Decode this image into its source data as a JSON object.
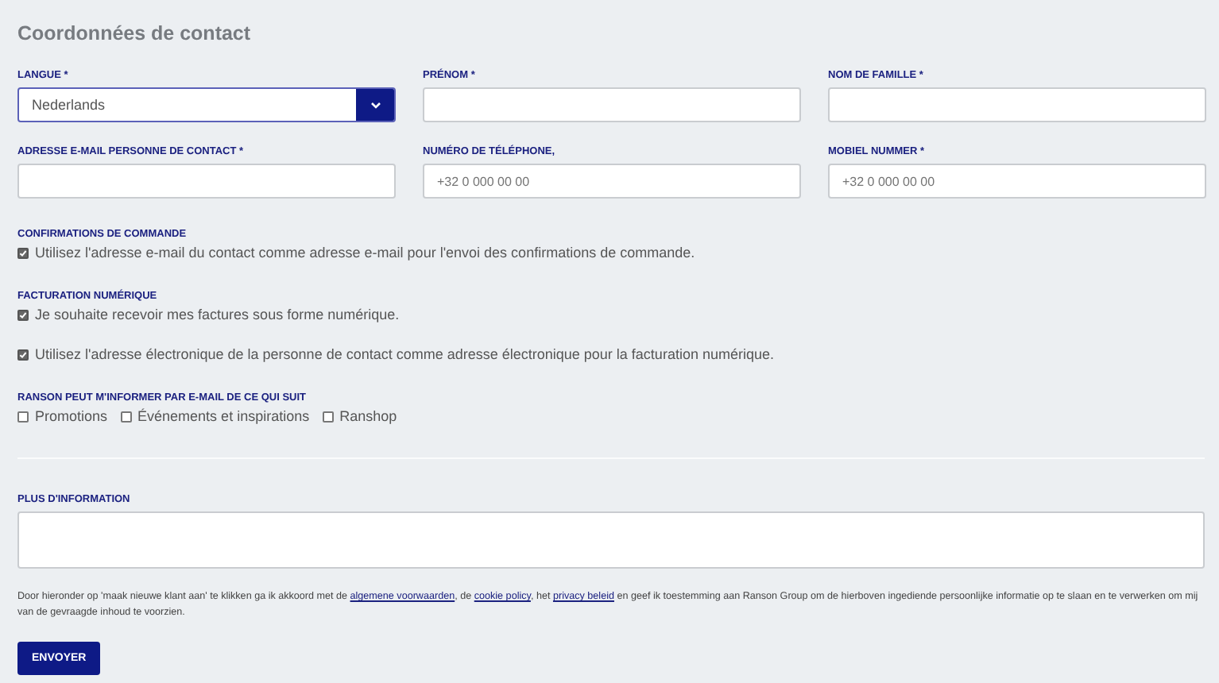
{
  "title": "Coordonnées de contact",
  "fields": [
    {
      "label": "LANGUE *",
      "kind": "select",
      "value": "Nederlands"
    },
    {
      "label": "PRÉNOM *",
      "kind": "text"
    },
    {
      "label": "NOM DE FAMILLE *",
      "kind": "text"
    },
    {
      "label": "ADRESSE E-MAIL PERSONNE DE CONTACT *",
      "kind": "text"
    },
    {
      "label": "NUMÉRO DE TÉLÉPHONE,",
      "kind": "text",
      "placeholder": "+32 0 000 00 00"
    },
    {
      "label": "MOBIEL NUMMER *",
      "kind": "text",
      "placeholder": "+32 0 000 00 00"
    }
  ],
  "groups": [
    {
      "heading": "CONFIRMATIONS DE COMMANDE",
      "inline": false,
      "options": [
        {
          "label": "Utilisez l'adresse e-mail du contact comme adresse e-mail pour l'envoi des confirmations de commande.",
          "checked": true
        }
      ]
    },
    {
      "heading": "FACTURATION NUMÉRIQUE",
      "inline": false,
      "options": [
        {
          "label": "Je souhaite recevoir mes factures sous forme numérique.",
          "checked": true
        },
        {
          "label": "Utilisez l'adresse électronique de la personne de contact comme adresse électronique pour la facturation numérique.",
          "checked": true
        }
      ]
    },
    {
      "heading": "RANSON PEUT M'INFORMER PAR E-MAIL DE CE QUI SUIT",
      "inline": true,
      "options": [
        {
          "label": "Promotions",
          "checked": false
        },
        {
          "label": "Événements et inspirations",
          "checked": false
        },
        {
          "label": "Ranshop",
          "checked": false
        }
      ]
    }
  ],
  "more_info": {
    "label": "PLUS D'INFORMATION"
  },
  "consent": [
    {
      "kind": "text",
      "text": "Door hieronder op 'maak nieuwe klant aan' te klikken ga ik akkoord met de "
    },
    {
      "kind": "link",
      "text": "algemene voorwaarden"
    },
    {
      "kind": "text",
      "text": ", de "
    },
    {
      "kind": "link",
      "text": "cookie policy"
    },
    {
      "kind": "text",
      "text": ", het "
    },
    {
      "kind": "link",
      "text": "privacy beleid"
    },
    {
      "kind": "text",
      "text": " en geef ik toestemming aan Ranson Group om de hierboven ingediende persoonlijke informatie op te slaan en te verwerken om mij van de gevraagde inhoud te voorzien."
    }
  ],
  "submit": "ENVOYER"
}
